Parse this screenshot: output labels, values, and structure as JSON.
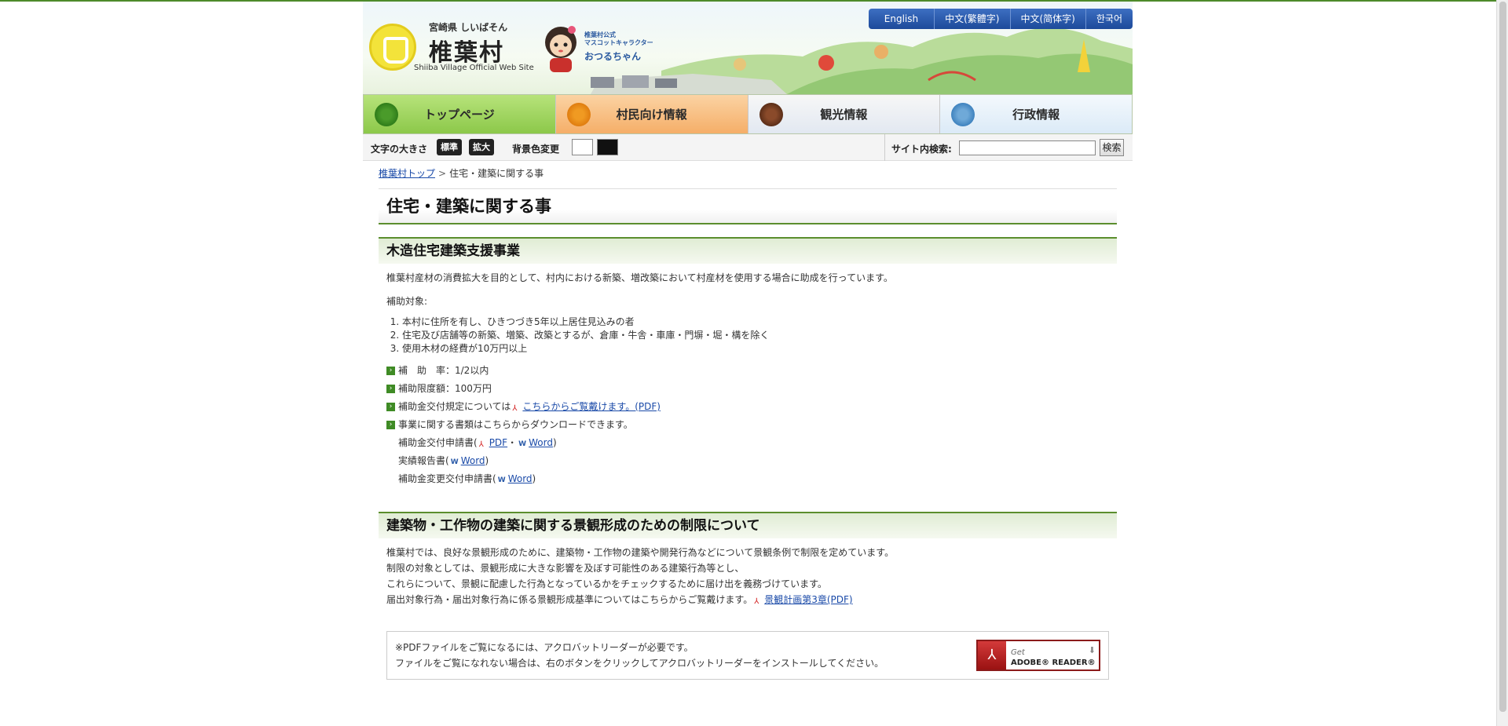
{
  "header": {
    "prefecture": "宮崎県 しいばそん",
    "village_name": "椎葉村",
    "site_en": "Shiiba Village Official Web Site",
    "mascot_caption": "椎葉村公式\nマスコットキャラクター",
    "mascot_name": "おつるちゃん",
    "languages": [
      "English",
      "中文(繁體字)",
      "中文(简体字)",
      "한국어"
    ]
  },
  "nav": {
    "items": [
      "トップページ",
      "村民向け情報",
      "観光情報",
      "行政情報"
    ]
  },
  "util": {
    "font_size_label": "文字の大きさ",
    "standard": "標準",
    "large": "拡大",
    "bg_label": "背景色変更",
    "search_label": "サイト内検索:",
    "search_button": "検索",
    "search_value": ""
  },
  "breadcrumb": {
    "home": "椎葉村トップ",
    "sep": ">",
    "current": "住宅・建築に関する事"
  },
  "page_title": "住宅・建築に関する事",
  "section1": {
    "heading": "木造住宅建築支援事業",
    "intro": "椎葉村産材の消費拡大を目的として、村内における新築、増改築において村産材を使用する場合に助成を行っています。",
    "target_label": "補助対象:",
    "targets": [
      "本村に住所を有し、ひきつづき5年以上居住見込みの者",
      "住宅及び店舗等の新築、増築、改築とするが、倉庫・牛舎・車庫・門塀・堀・構を除く",
      "使用木材の経費が10万円以上"
    ],
    "bullets": {
      "rate": "補　助　率：1/2以内",
      "limit": "補助限度額：100万円",
      "rule_prefix": "補助金交付規定については",
      "rule_link": "こちらからご覧戴けます。(PDF)",
      "download": "事業に関する書類はこちらからダウンロードできます。"
    },
    "docs": {
      "app_label": "補助金交付申請書(",
      "pdf": "PDF",
      "dot": "・",
      "word": "Word",
      "close": ")",
      "report_label": "実績報告書(",
      "change_label": "補助金変更交付申請書("
    }
  },
  "section2": {
    "heading": "建築物・工作物の建築に関する景観形成のための制限について",
    "lines": [
      "椎葉村では、良好な景観形成のために、建築物・工作物の建築や開発行為などについて景観条例で制限を定めています。",
      "制限の対象としては、景観形成に大きな影響を及ぼす可能性のある建築行為等とし、",
      "これらについて、景観に配慮した行為となっているかをチェックするために届け出を義務づけています。"
    ],
    "last_prefix": "届出対象行為・届出対象行為に係る景観形成基準についてはこちらからご覧戴けます。",
    "last_link": "景観計画第3章(PDF)"
  },
  "reader": {
    "line1": "※PDFファイルをご覧になるには、アクロバットリーダーが必要です。",
    "line2": "ファイルをご覧になれない場合は、右のボタンをクリックしてアクロバットリーダーをインストールしてください。",
    "btn_get": "Get",
    "btn_name": "ADOBE® READER®"
  },
  "colors": {
    "accent_green": "#5b8e2d",
    "link_blue": "#1a4aa8",
    "lang_blue": "#1d4a9a"
  }
}
